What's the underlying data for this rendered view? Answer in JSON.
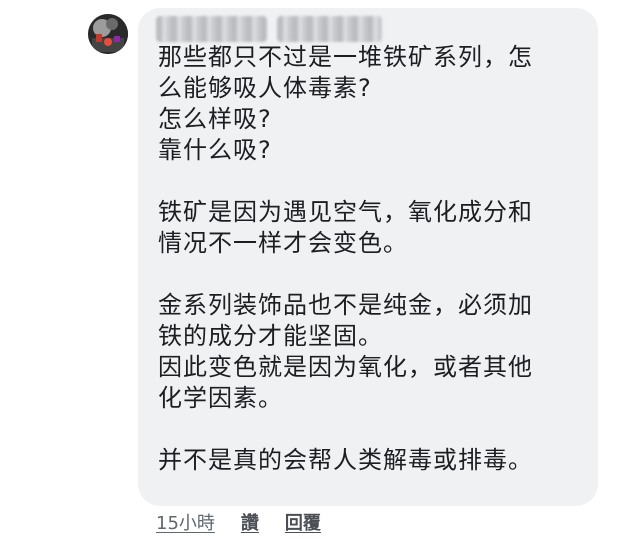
{
  "comment": {
    "author_name": "",
    "text": "那些都只不过是一堆铁矿系列，怎\n么能够吸人体毒素?\n怎么样吸?\n靠什么吸?\n\n铁矿是因为遇见空气，氧化成分和\n情况不一样才会变色。\n\n金系列装饰品也不是纯金，必须加\n铁的成分才能坚固。\n因此变色就是因为氧化，或者其他\n化学因素。\n\n并不是真的会帮人类解毒或排毒。"
  },
  "actions": {
    "timestamp": "15小時",
    "like_label": "讚",
    "reply_label": "回覆"
  }
}
